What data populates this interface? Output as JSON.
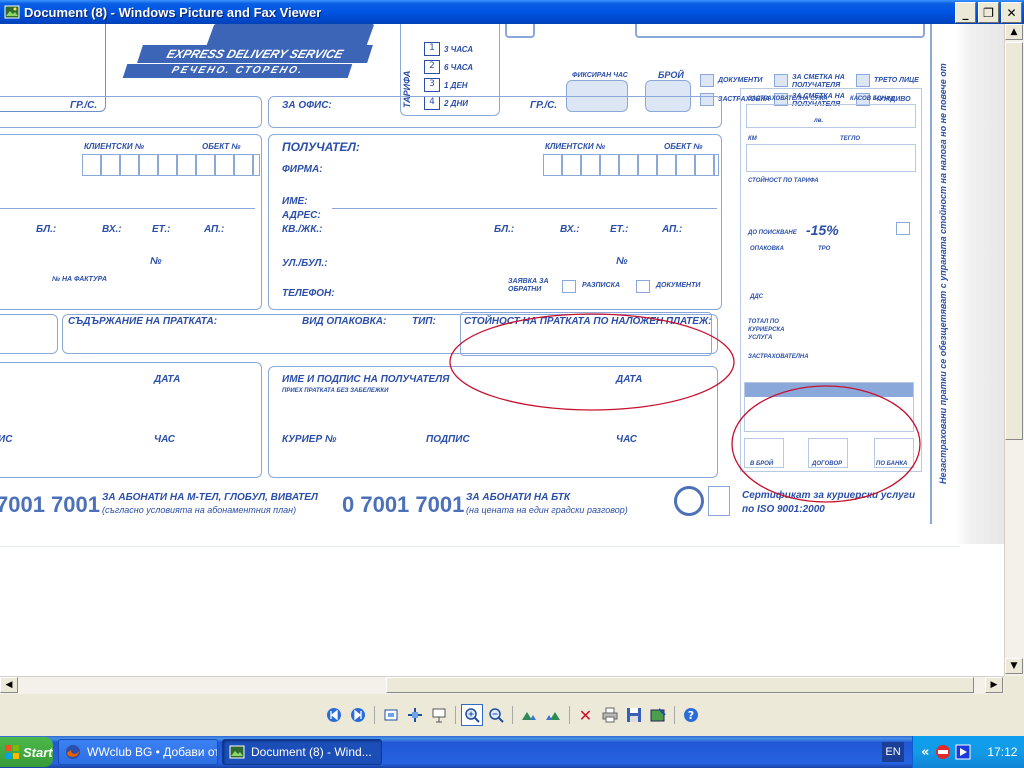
{
  "window": {
    "title": "Document (8) - Windows Picture and Fax Viewer"
  },
  "doc": {
    "brand": "EXPRESS DELIVERY SERVICE",
    "slogan": "РЕЧЕНО. СТОРЕНО.",
    "tariff_label": "ТАРИФА",
    "tariff": [
      "3 ЧАСА",
      "6 ЧАСА",
      "1 ДЕН",
      "2 ДНИ"
    ],
    "fixed_hour": "ФИКСИРАН ЧАС",
    "count": "БРОЙ",
    "docs": "ДОКУМЕНТИ",
    "for_recipient": "ЗА СМЕТКА НА ПОЛУЧАТЕЛЯ",
    "third": "ТРЕТО ЛИЦЕ",
    "insurance": "ЗАСТРАХОВКА",
    "for_recipient2": "ЗА СМЕТКА НА ПОЛУЧАТЕЛЯ",
    "foreign": "ЧУЖДИВО",
    "city1": "ГР./С.",
    "office": "ЗА ОФИС:",
    "city2": "ГР./С.",
    "client_no1": "КЛИЕНТСКИ №",
    "object_no1": "ОБЕКТ №",
    "client_no2": "КЛИЕНТСКИ №",
    "object_no2": "ОБЕКТ №",
    "recipient": "ПОЛУЧАТЕЛ:",
    "company": "ФИРМА:",
    "name": "ИМЕ:",
    "address": "АДРЕС:",
    "kv": "КВ./ЖК.:",
    "bl": "БЛ.:",
    "vh": "ВХ.:",
    "et": "ЕТ.:",
    "ap": "АП.:",
    "bl2": "БЛ.:",
    "vh2": "ВХ.:",
    "et2": "ЕТ.:",
    "ap2": "АП.:",
    "street": "УЛ./БУЛ.:",
    "no": "№",
    "no2": "№",
    "invoice": "№ НА ФАКТУРА",
    "phone": "ТЕЛЕФОН:",
    "request": "ЗАЯВКА ЗА ОБРАТНИ",
    "receipt": "РАЗПИСКА",
    "documents": "ДОКУМЕНТИ",
    "contents": "СЪДЪРЖАНИЕ НА ПРАТКАТА:",
    "packaging": "ВИД ОПАКОВКА:",
    "type": "ТИП:",
    "cod": "СТОЙНОСТ НА ПРАТКАТА ПО НАЛОЖЕН ПЛАТЕЖ:",
    "date1": "ДАТА",
    "sign_recipient": "ИМЕ И ПОДПИС НА ПОЛУЧАТЕЛЯ",
    "accepted": "ПРИЕХ ПРАТКАТА БЕЗ ЗАБЕЛЕЖКИ",
    "date2": "ДАТА",
    "sign1_left": "ИС",
    "hour1": "ЧАС",
    "courier": "КУРИЕР №",
    "signature": "ПОДПИС",
    "hour2": "ЧАС",
    "phone1": "7001 7001",
    "phone1_text": "ЗА АБОНАТИ НА М-ТЕЛ, ГЛОБУЛ, ВИВАТЕЛ",
    "phone1_note": "(съгласно условията на абонаментния план)",
    "phone2": "0 7001 7001",
    "phone2_text": "ЗА АБОНАТИ НА БТК",
    "phone2_note": "(на цената на един градски разговор)",
    "cert1": "Сертификат за куриерски услуги",
    "cert2": "по ISO 9001:2000",
    "insured_sum": "ЗАСТРАХОВАТЕЛНА СУМА",
    "cash_bon": "КАСОВ БОН №",
    "lv": "лв.",
    "km": "КМ",
    "weight": "ТЕГЛО",
    "tariff_value": "СТОЙНОСТ ПО ТАРИФА",
    "discount": "ДО ПОИСКВАНЕ",
    "discount_val": "-15%",
    "packing": "ОПАКОВКА",
    "tro": "ТРО",
    "vat": "ДДС",
    "total": "ТОТАЛ ПО КУРИЕРСКА УСЛУГА",
    "insurance2": "ЗАСТРАХОВАТЕЛНА",
    "in_cash": "В БРОЙ",
    "contract": "ДОГОВОР",
    "bank": "ПО БАНКА",
    "side_text": "Незастраховани пратки се обезщетяват с упраната стойност на налога но не повече от"
  },
  "toolbar": [
    "prev-image",
    "next-image",
    "best-fit",
    "actual-size",
    "slideshow",
    "zoom-in",
    "zoom-out",
    "rotate-cw",
    "rotate-ccw",
    "delete",
    "print",
    "save",
    "open-editor",
    "help"
  ],
  "taskbar": {
    "start": "Start",
    "tasks": [
      {
        "label": "WWclub BG • Добави от...",
        "active": false
      },
      {
        "label": "Document (8) - Wind...",
        "active": true
      }
    ],
    "lang": "EN",
    "chevron": "«",
    "time": "17:12"
  }
}
